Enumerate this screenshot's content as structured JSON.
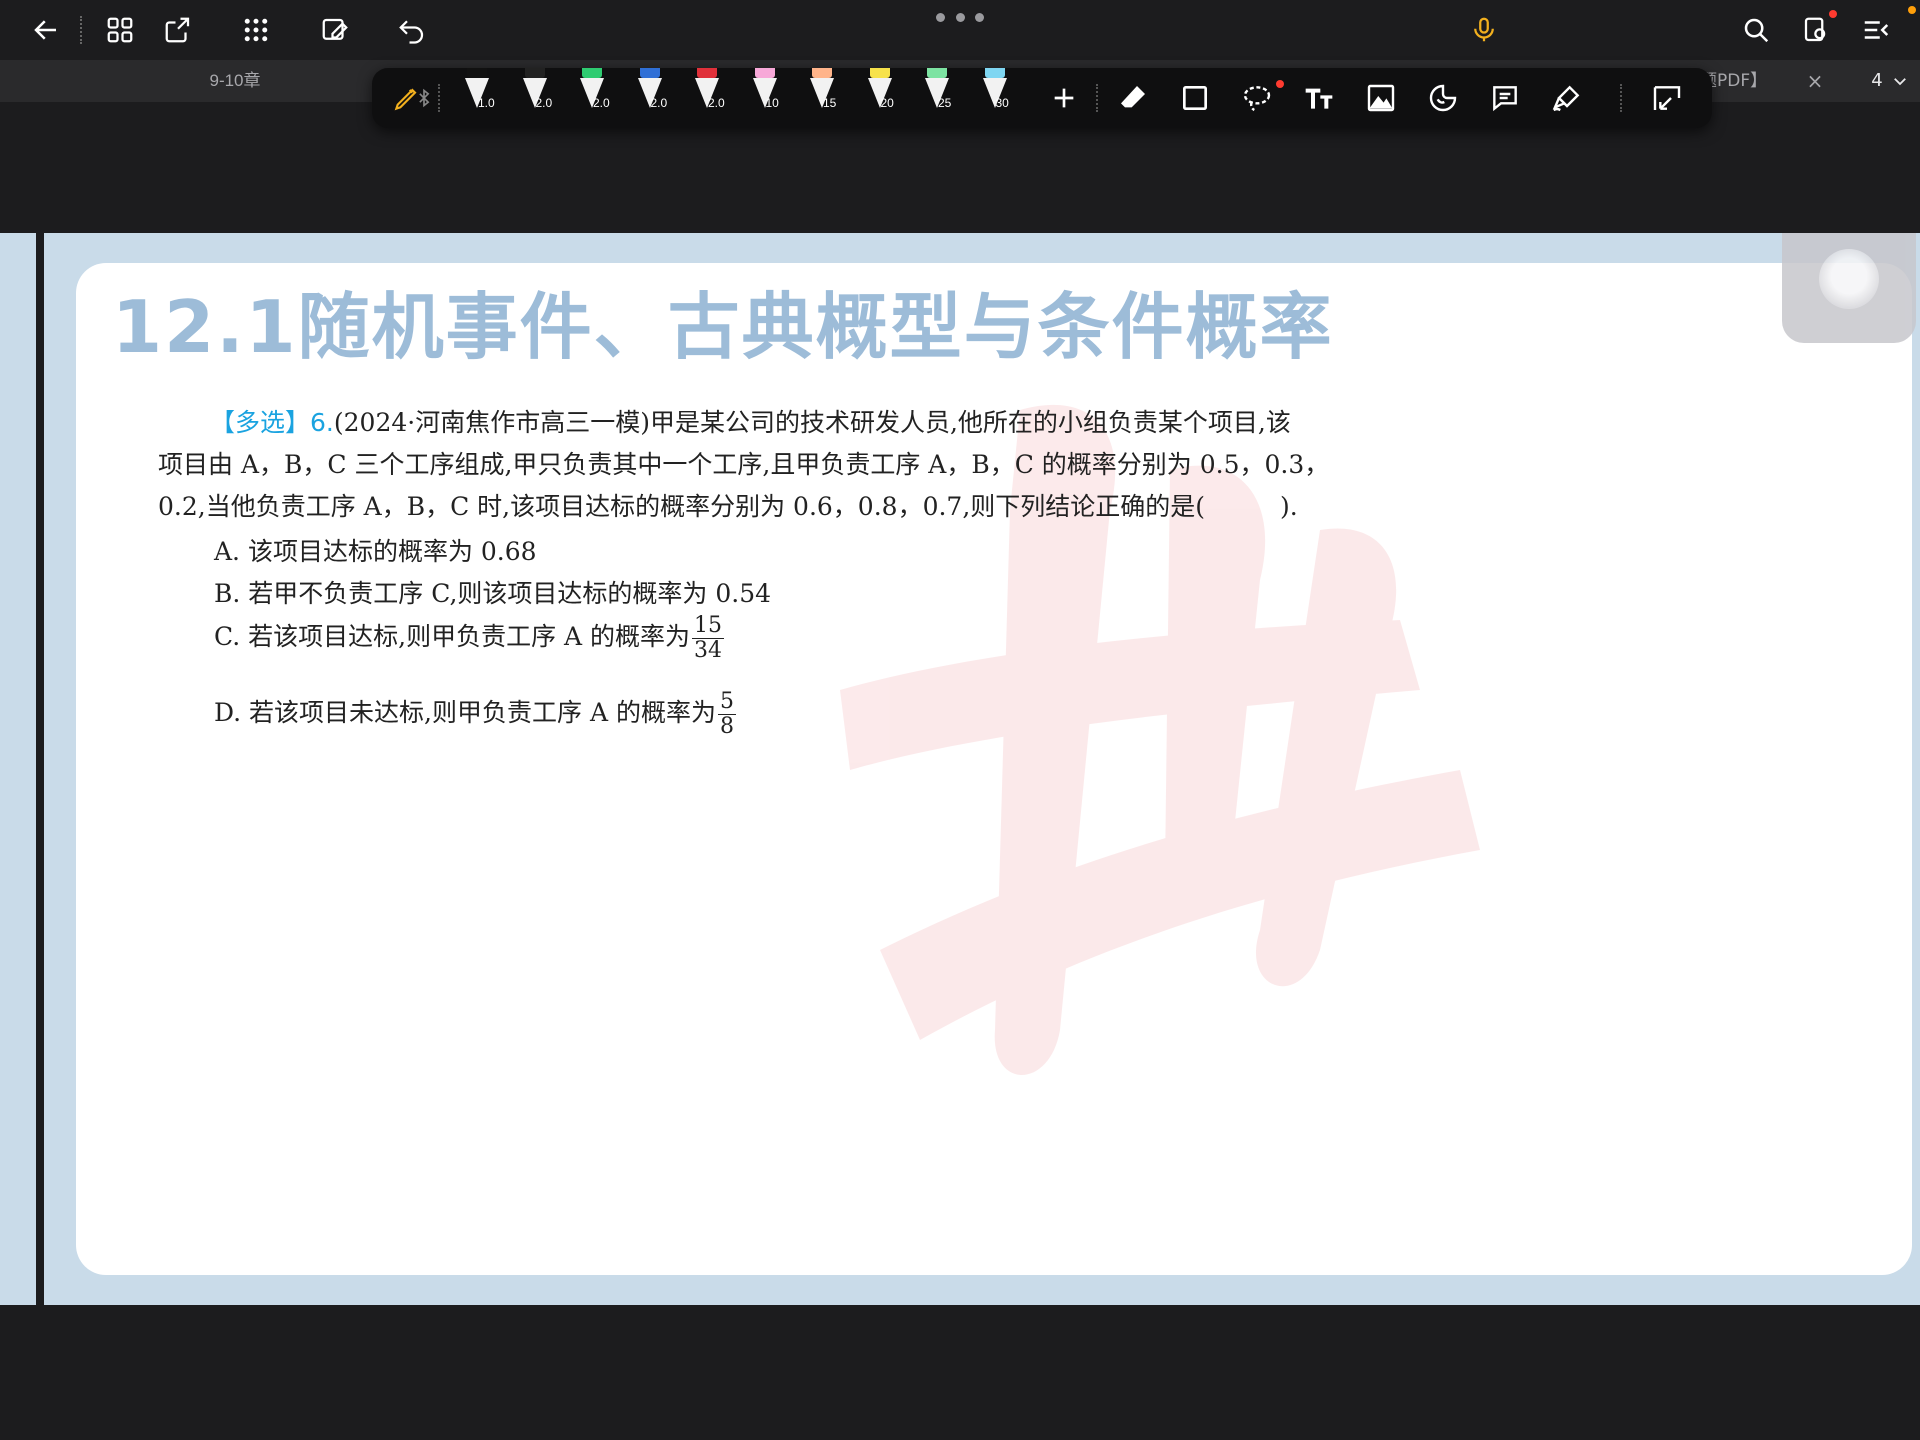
{
  "tabs": {
    "left_label": "9-10章",
    "right_label": "题PDF】",
    "close_glyph": "×"
  },
  "page_indicator": {
    "value": "4"
  },
  "pen_sizes": [
    "1.0",
    "2.0",
    "2.0",
    "2.0",
    "2.0",
    "10",
    "15",
    "20",
    "25",
    "30"
  ],
  "pen_colors": [
    "#111111",
    "#222222",
    "#2ecc71",
    "#2f6fd6",
    "#e0303a",
    "#f7a8d8",
    "#ffb48a",
    "#f7e24a",
    "#7de3a2",
    "#7fd6f2"
  ],
  "colors": {
    "accent": "#1aa3e0",
    "heading": "#9dbcd8",
    "mic": "#f2b01e"
  },
  "icons": [
    "back-arrow-icon",
    "grid-icon",
    "export-icon",
    "apps-icon",
    "edit-page-icon",
    "undo-icon",
    "more-dots-icon",
    "microphone-icon",
    "search-icon",
    "page-settings-icon",
    "menu-icon",
    "pen-icon",
    "bluetooth-icon",
    "add-icon",
    "eraser-icon",
    "shape-icon",
    "lasso-icon",
    "text-icon",
    "image-icon",
    "sticker-icon",
    "comment-icon",
    "highlighter-icon",
    "crop-icon"
  ],
  "document": {
    "heading": "12.1随机事件、古典概型与条件概率",
    "question": {
      "tag": "【多选】",
      "number": "6.",
      "line1_rest": "(2024·河南焦作市高三一模)甲是某公司的技术研发人员,他所在的小组负责某个项目,该",
      "line2": "项目由 A，B，C 三个工序组成,甲只负责其中一个工序,且甲负责工序 A，B，C 的概率分别为 0.5，0.3，",
      "line3": "0.2,当他负责工序 A，B，C 时,该项目达标的概率分别为 0.6，0.8，0.7,则下列结论正确的是(　　　)."
    },
    "options": {
      "a": "A.  该项目达标的概率为 0.68",
      "b": "B.  若甲不负责工序 C,则该项目达标的概率为 0.54",
      "c_text": "C.  若该项目达标,则甲负责工序 A 的概率为",
      "c_num": "15",
      "c_den": "34",
      "d_text": "D.  若该项目未达标,则甲负责工序 A 的概率为",
      "d_num": "5",
      "d_den": "8"
    }
  }
}
